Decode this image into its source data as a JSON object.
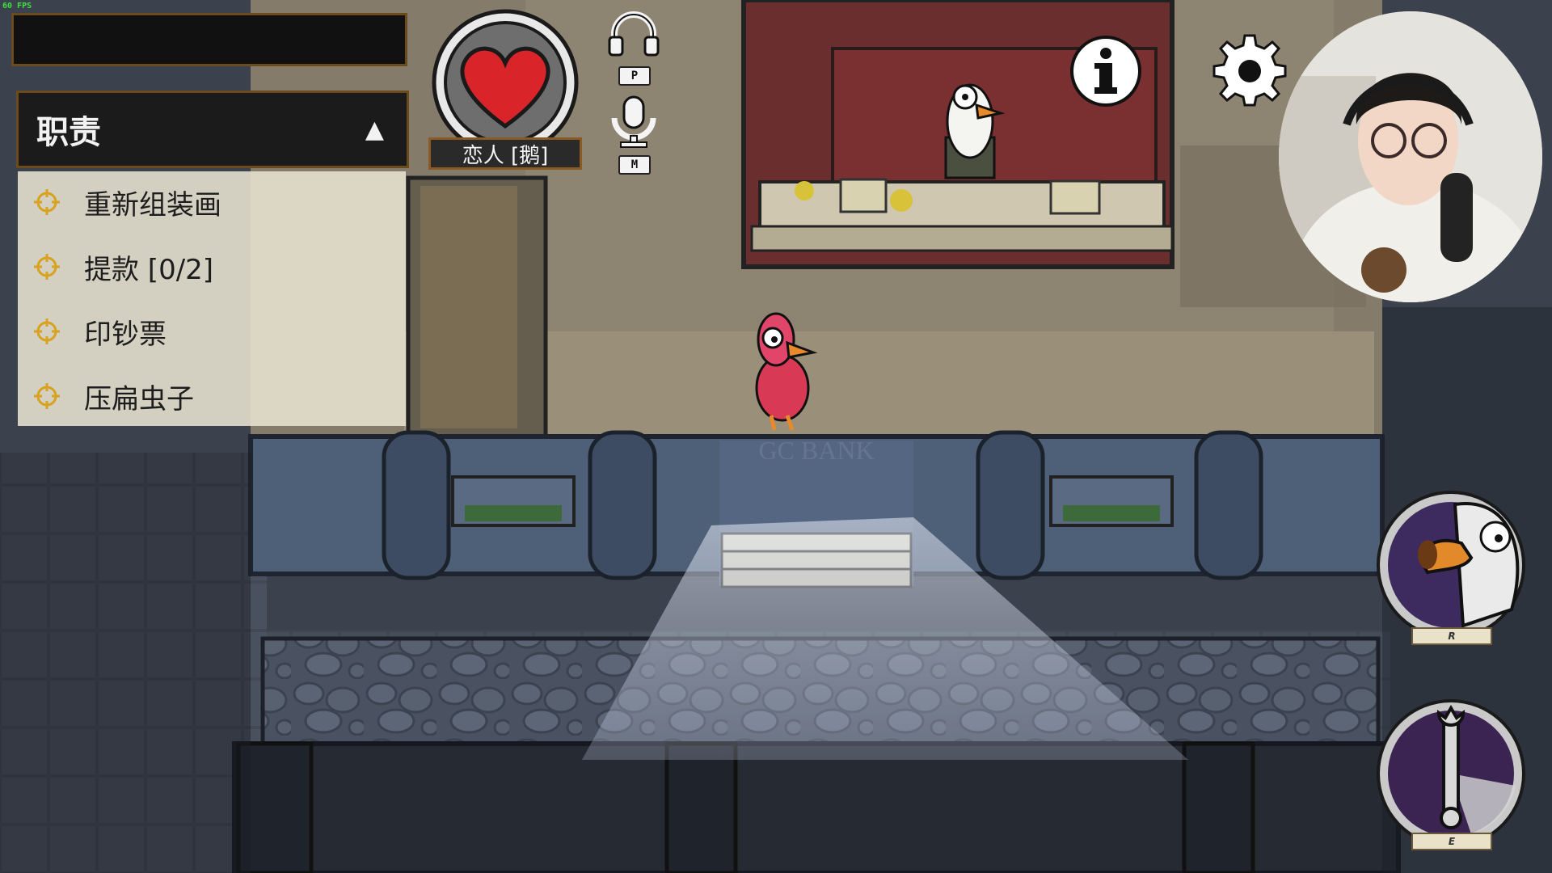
{
  "fps": "60 FPS",
  "tasks": {
    "title": "职责",
    "toggle": "▲",
    "items": [
      {
        "label": "重新组装画"
      },
      {
        "label": "提款 [0/2]"
      },
      {
        "label": "印钞票"
      },
      {
        "label": "压扁虫子"
      }
    ]
  },
  "role": {
    "label": "恋人 [鹅]"
  },
  "hud": {
    "headphones_key": "P",
    "mic_key": "M"
  },
  "scene": {
    "sign": "GC BANK"
  },
  "abilities": {
    "honk_key": "R",
    "use_key": "E"
  }
}
